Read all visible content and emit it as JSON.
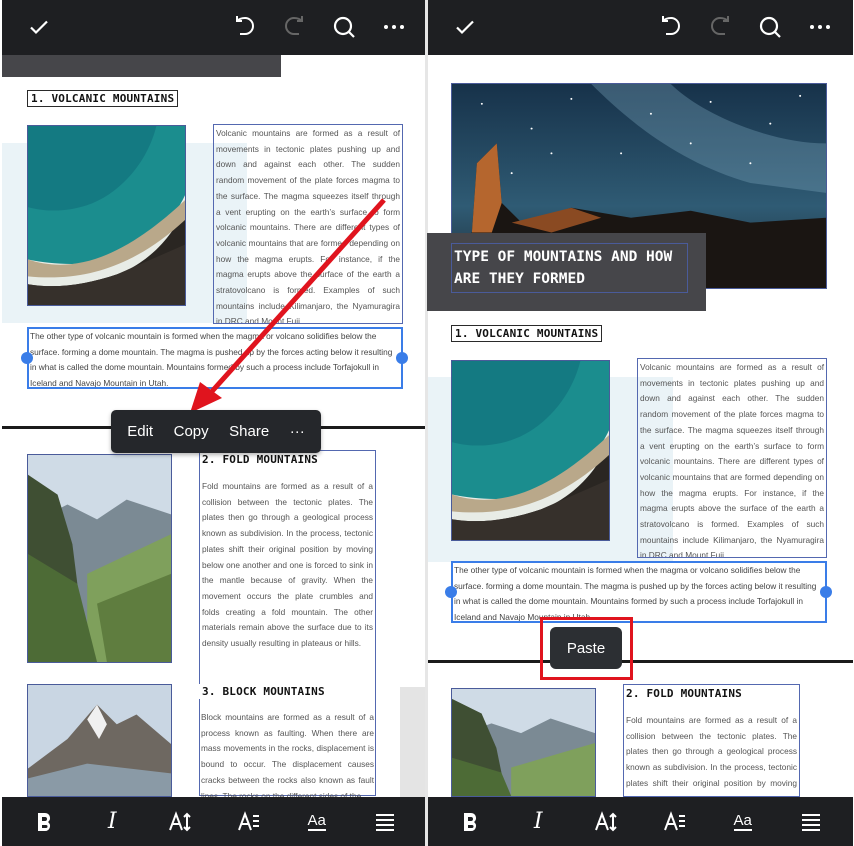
{
  "toolbar": {
    "icons": [
      "check-icon",
      "undo-icon",
      "redo-icon",
      "search-icon",
      "more-icon"
    ]
  },
  "format_bar": {
    "icons": [
      "bold-icon",
      "italic-icon",
      "font-size-icon",
      "text-style-icon",
      "font-icon",
      "align-icon"
    ],
    "italic_glyph": "I",
    "font_glyph": "Aa"
  },
  "document": {
    "banner_title": "TYPE OF MOUNTAINS AND HOW ARE THEY FORMED",
    "section1": {
      "heading": "1. VOLCANIC MOUNTAINS",
      "body": "Volcanic mountains are formed as a result of movements in tectonic plates pushing up and down and against each other. The sudden random movement of the plate forces magma to the surface. The magma squeezes itself through a vent erupting on the earth’s surface to form volcanic mountains. There are different types of volcanic mountains that are formed depending on how the magma erupts. For instance, if the magma erupts above the surface of the earth a stratovolcano is formed. Examples of such mountains include Kilimanjaro, the Nyamuragira in DRC and Mount Fuji.",
      "selected_paragraph": "The other type of volcanic mountain is formed when the magma or volcano solidifies below the surface. forming a dome mountain. The magma is pushed up by the forces acting below it resulting in what is called the dome mountain. Mountains formed by such a process include Torfajokull in Iceland and Navajo Mountain in Utah."
    },
    "section2": {
      "heading": "2. FOLD MOUNTAINS",
      "body": "Fold mountains are formed as a result of a collision between the tectonic plates. The plates then go through a geological process known as subdivision. In the process, tectonic plates shift their original position by moving below one another and one is forced to sink in the mantle because of gravity. When the movement occurs the plate crumbles and folds creating a fold mountain. The other materials remain above the surface due to its density usually resulting in plateaus or hills."
    },
    "section3": {
      "heading": "3. BLOCK MOUNTAINS",
      "body": "Block mountains are formed as a result of a process known as faulting. When there are mass movements in the rocks, displacement is bound to occur. The displacement causes cracks between the rocks also known as fault lines. The rocks on the different sides of the"
    }
  },
  "context_menu": {
    "edit": "Edit",
    "copy": "Copy",
    "share": "Share",
    "more": "···"
  },
  "paste_label": "Paste",
  "colors": {
    "toolbar_bg": "#1e1f22",
    "selection": "#3a7de8",
    "highlight": "#e0141e",
    "arrow": "#e0141e"
  }
}
